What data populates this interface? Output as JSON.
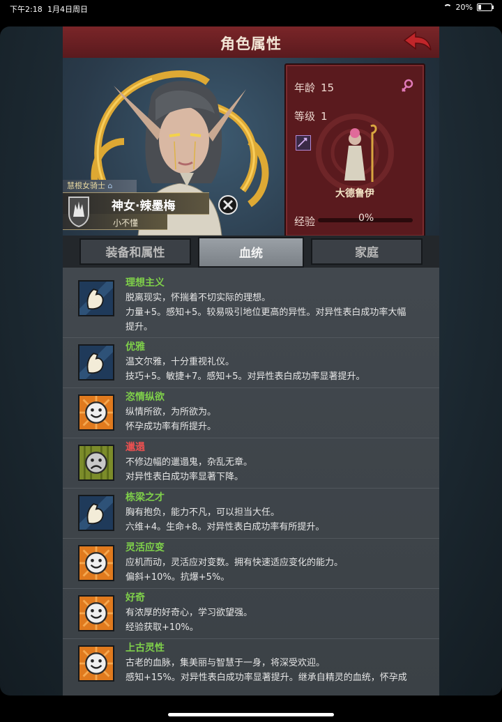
{
  "status_bar": {
    "time": "下午2:18",
    "date": "1月4日周日",
    "battery": "20%",
    "battery_level": 0.2
  },
  "header": {
    "title": "角色属性"
  },
  "character": {
    "class": "慧根女骑士",
    "name": "神女·辣墨梅",
    "title": "小不懂"
  },
  "stats": {
    "age_label": "年龄",
    "age": "15",
    "level_label": "等级",
    "level": "1",
    "job": "大德鲁伊",
    "exp_label": "经验",
    "exp_pct": "0%",
    "exp_fraction": 0
  },
  "tabs": [
    {
      "label": "装备和属性"
    },
    {
      "label": "血统"
    },
    {
      "label": "家庭"
    }
  ],
  "traits": [
    {
      "name": "理想主义",
      "icon": "arm-icon",
      "type": "good",
      "lines": [
        "脱离现实，怀揣着不切实际的理想。",
        "力量+5。感知+5。较易吸引地位更高的异性。对异性表白成功率大幅",
        "提升。"
      ]
    },
    {
      "name": "优雅",
      "icon": "arm-icon",
      "type": "good",
      "lines": [
        "温文尔雅，十分重视礼仪。",
        "技巧+5。敏捷+7。感知+5。对异性表白成功率显著提升。"
      ]
    },
    {
      "name": "恣情纵欲",
      "icon": "smile-icon",
      "type": "good",
      "lines": [
        "纵情所欲，为所欲为。",
        "怀孕成功率有所提升。"
      ]
    },
    {
      "name": "邋遢",
      "icon": "frown-icon",
      "type": "bad",
      "lines": [
        "不修边幅的邋遢鬼，杂乱无章。",
        "对异性表白成功率显著下降。"
      ]
    },
    {
      "name": "栋梁之才",
      "icon": "arm-icon",
      "type": "good",
      "lines": [
        "胸有抱负，能力不凡，可以担当大任。",
        "六维+4。生命+8。对异性表白成功率有所提升。"
      ]
    },
    {
      "name": "灵活应变",
      "icon": "smile-icon",
      "type": "good",
      "lines": [
        "应机而动，灵活应对变数。拥有快速适应变化的能力。",
        "偏斜+10%。抗爆+5%。"
      ]
    },
    {
      "name": "好奇",
      "icon": "smile-icon",
      "type": "good",
      "lines": [
        "有浓厚的好奇心，学习欲望强。",
        "经验获取+10%。"
      ]
    },
    {
      "name": "上古灵性",
      "icon": "smile-icon",
      "type": "good",
      "lines": [
        "古老的血脉，集美丽与智慧于一身，将深受欢迎。",
        "感知+15%。对异性表白成功率显著提升。继承自精灵的血统，怀孕成"
      ]
    }
  ],
  "colors": {
    "header": "#6b1f23",
    "good": "#7fd04a",
    "bad": "#e85050",
    "card": "#5a1a1e"
  }
}
